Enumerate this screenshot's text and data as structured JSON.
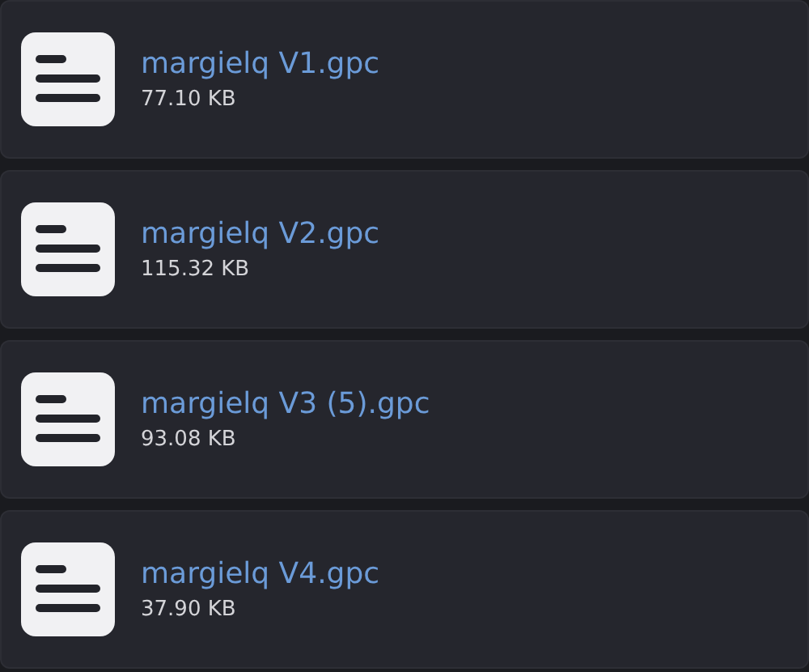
{
  "files": [
    {
      "name": "margielq V1.gpc",
      "size": "77.10 KB"
    },
    {
      "name": "margielq V2.gpc",
      "size": "115.32 KB"
    },
    {
      "name": "margielq V3 (5).gpc",
      "size": "93.08 KB"
    },
    {
      "name": "margielq V4.gpc",
      "size": "37.90 KB"
    }
  ]
}
